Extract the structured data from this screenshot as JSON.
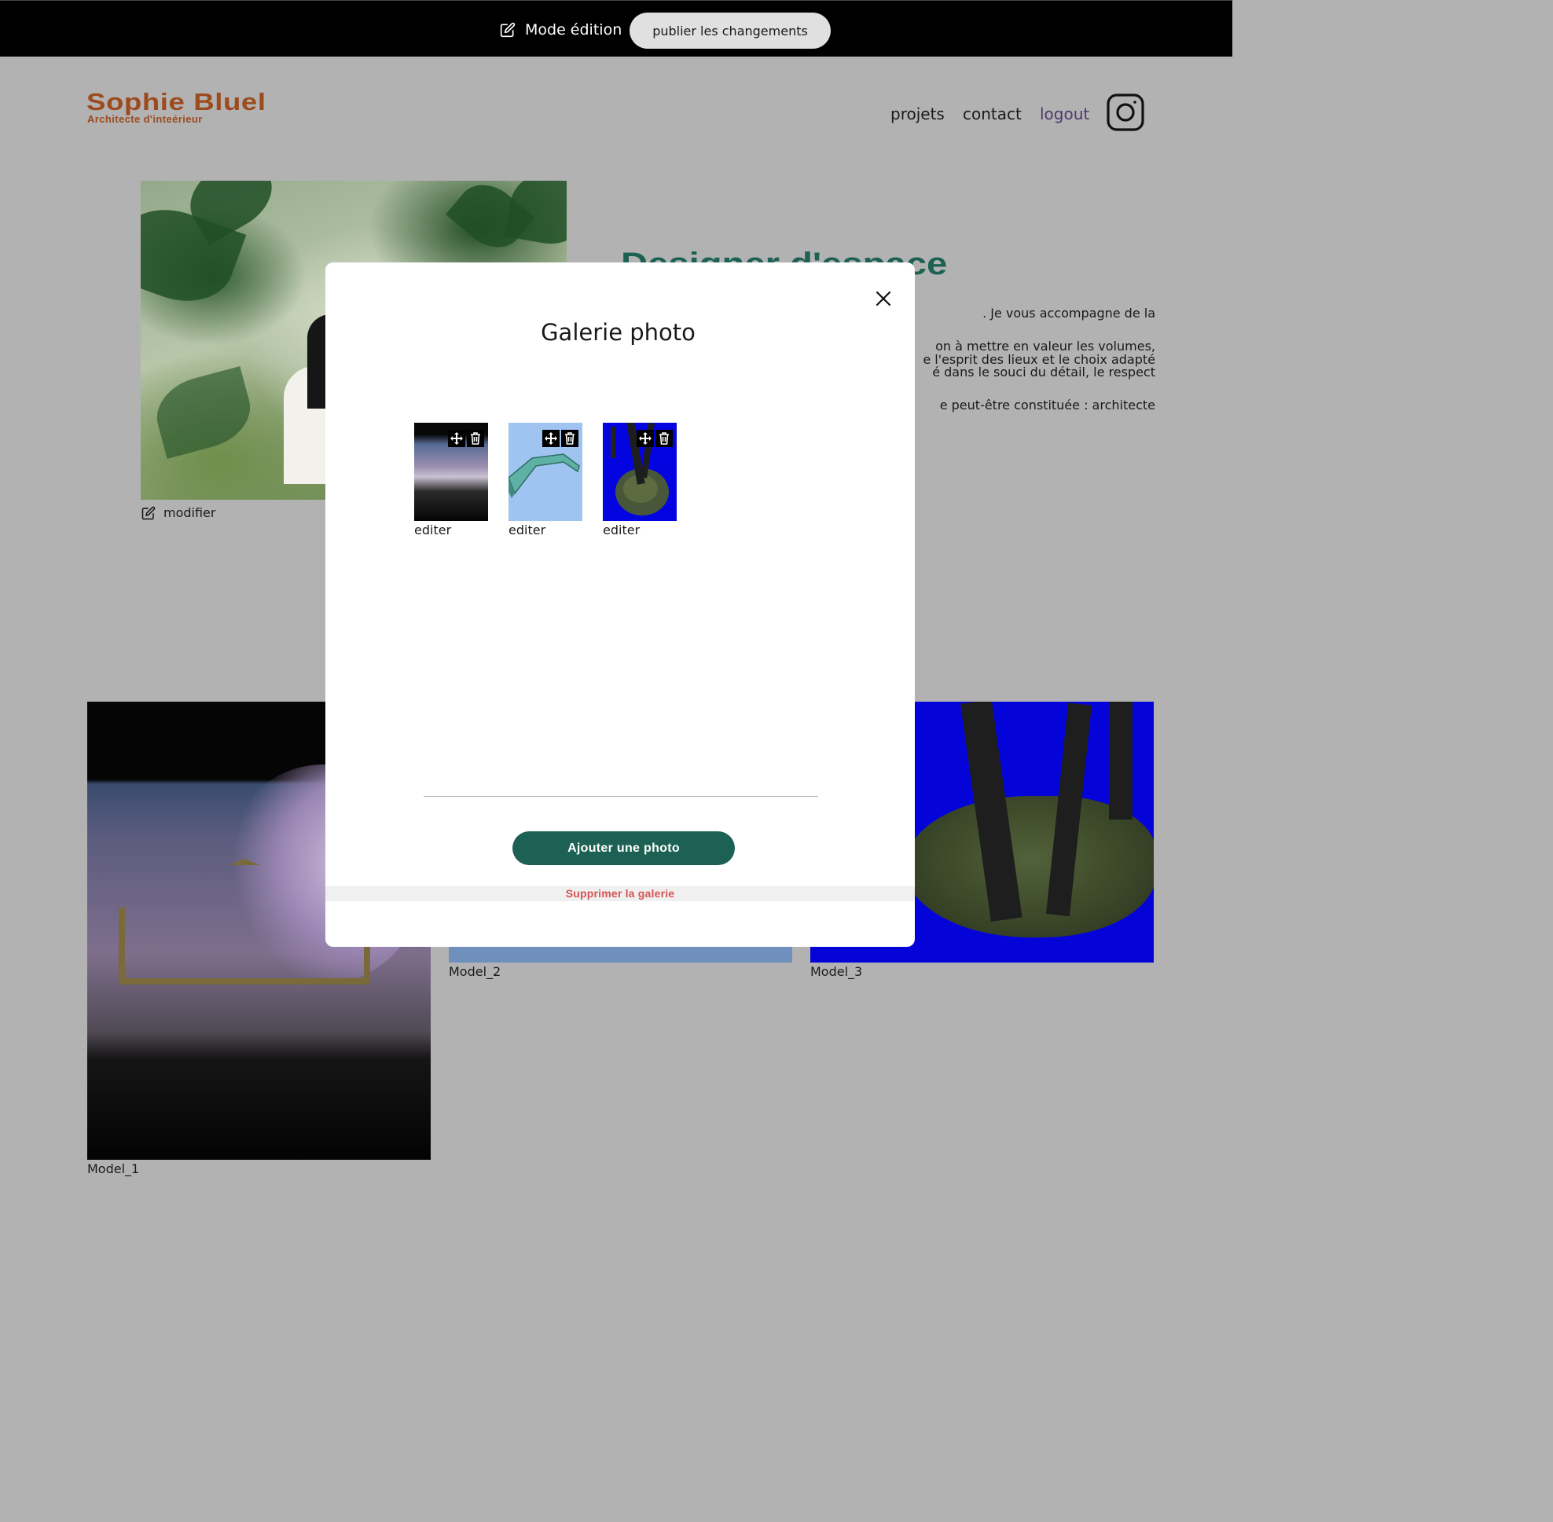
{
  "edit_bar": {
    "mode_label": "Mode édition",
    "publish_label": "publier les changements"
  },
  "header": {
    "logo_title": "Sophie Bluel",
    "logo_subtitle": "Architecte d'inteérieur",
    "nav": [
      {
        "label": "projets"
      },
      {
        "label": "contact"
      },
      {
        "label": "logout"
      }
    ],
    "social_icon": "instagram-icon"
  },
  "intro": {
    "photo_edit_label": "modifier",
    "title": "Designer d'espace",
    "paragraphs": [
      ". Je vous accompagne de la",
      "on à mettre en valeur les volumes,",
      "e l'esprit des lieux et le choix adapté",
      "é dans le souci du détail, le respect",
      "e peut-être constituée : architecte"
    ]
  },
  "gallery": {
    "items": [
      {
        "caption": "Model_1"
      },
      {
        "caption": "Model_2"
      },
      {
        "caption": "Model_3"
      }
    ]
  },
  "modal": {
    "title": "Galerie photo",
    "close_icon": "close-icon",
    "thumbnails": [
      {
        "caption": "editer",
        "icons": [
          "move-icon",
          "trash-icon"
        ]
      },
      {
        "caption": "editer",
        "icons": [
          "move-icon",
          "trash-icon"
        ]
      },
      {
        "caption": "editer",
        "icons": [
          "move-icon",
          "trash-icon"
        ]
      }
    ],
    "add_button_label": "Ajouter une photo",
    "delete_gallery_label": "Supprimer la galerie"
  },
  "colors": {
    "brand_orange": "#9c4b1e",
    "brand_green": "#1d6154",
    "overlay_gray": "#b2b2b2",
    "delete_red": "#d65353",
    "logout_purple": "#4b3a6e"
  }
}
